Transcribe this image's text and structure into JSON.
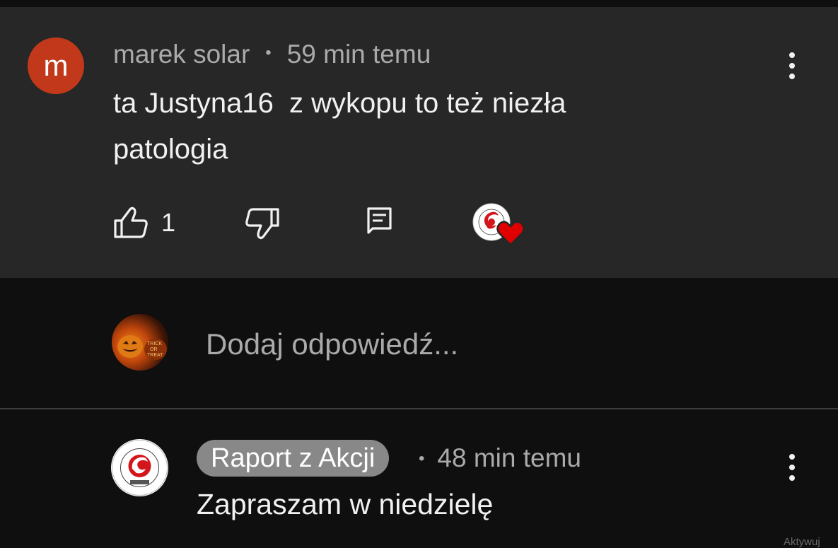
{
  "comment": {
    "avatar_letter": "m",
    "author": "marek solar",
    "separator": "•",
    "time": "59 min temu",
    "text": "ta Justyna16  z wykopu to też niezła\npatologia",
    "likes": "1",
    "avatar_color": "#c1391a"
  },
  "reply_box": {
    "placeholder": "Dodaj odpowiedź..."
  },
  "reply": {
    "author": "Raport z Akcji",
    "separator": "•",
    "time": "48 min temu",
    "text": "Zapraszam w niedzielę"
  },
  "watermark": "Aktywuj",
  "colors": {
    "card_bg": "#272727",
    "page_bg": "#0f0f0f",
    "heart": "#e00000",
    "author_chip": "#888888"
  },
  "icons": {
    "like": "thumbs-up-icon",
    "dislike": "thumbs-down-icon",
    "reply": "comment-icon",
    "heart": "heart-icon",
    "more": "more-vert-icon"
  }
}
